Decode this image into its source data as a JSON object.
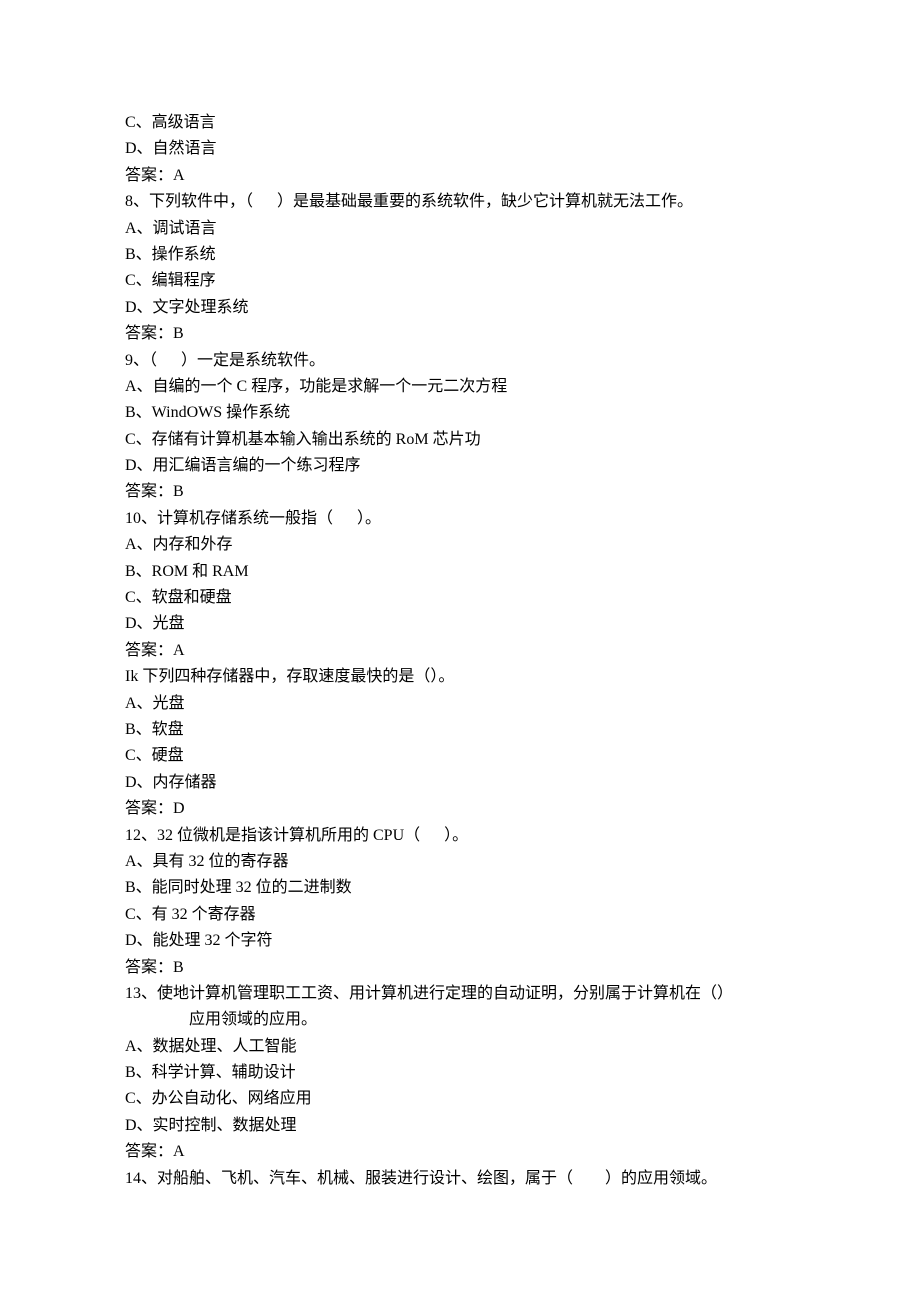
{
  "lines": [
    "C、高级语言",
    "D、自然语言",
    "答案：A",
    "8、下列软件中，（      ）是最基础最重要的系统软件，缺少它计算机就无法工作。",
    "A、调试语言",
    "B、操作系统",
    "C、编辑程序",
    "D、文字处理系统",
    "答案：B",
    "9、（      ）一定是系统软件。",
    "A、自编的一个 C 程序，功能是求解一个一元二次方程",
    "B、WindOWS 操作系统",
    "C、存储有计算机基本输入输出系统的 RoM 芯片功",
    "D、用汇编语言编的一个练习程序",
    "答案：B",
    "10、计算机存储系统一般指（      ）。",
    "A、内存和外存",
    "B、ROM 和 RAM",
    "C、软盘和硬盘",
    "D、光盘",
    "答案：A",
    "Ik 下列四种存储器中，存取速度最快的是（）。",
    "A、光盘",
    "B、软盘",
    "C、硬盘",
    "D、内存储器",
    "答案：D",
    "12、32 位微机是指该计算机所用的 CPU（      ）。",
    "A、具有 32 位的寄存器",
    "B、能同时处理 32 位的二进制数",
    "C、有 32 个寄存器",
    "D、能处理 32 个字符",
    "答案：B",
    "13、使地计算机管理职工工资、用计算机进行定理的自动证明，分别属于计算机在（）",
    "INDENT:应用领域的应用。",
    "A、数据处理、人工智能",
    "B、科学计算、辅助设计",
    "C、办公自动化、网络应用",
    "D、实时控制、数据处理",
    "答案：A",
    "14、对船舶、飞机、汽车、机械、服装进行设计、绘图，属于（        ）的应用领域。"
  ]
}
